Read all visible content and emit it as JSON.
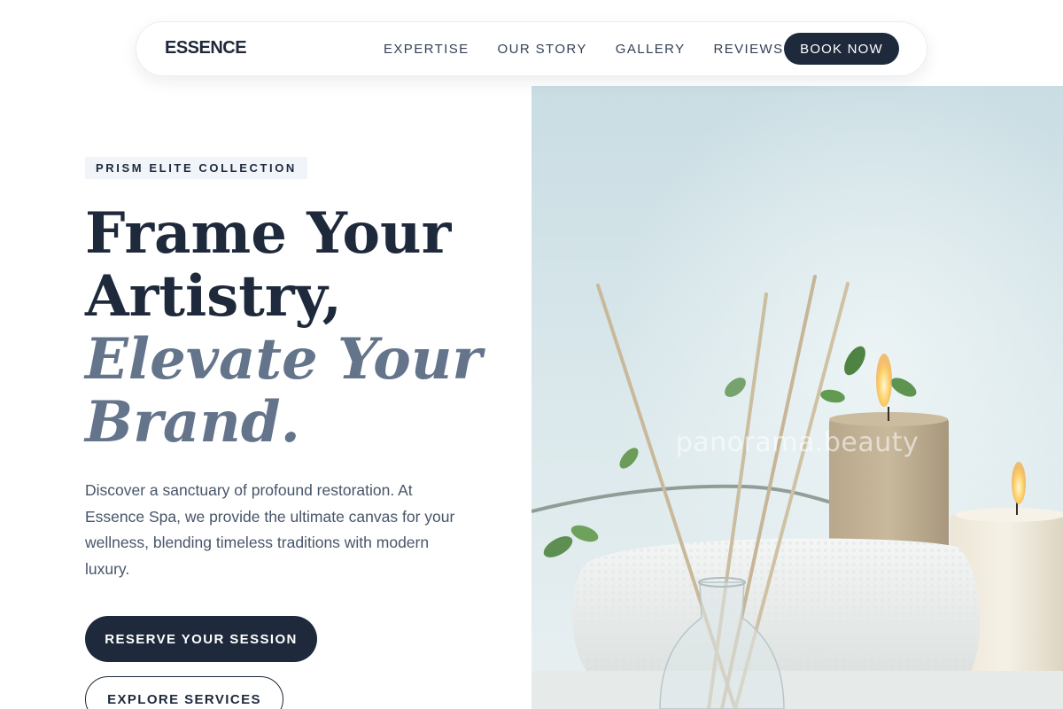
{
  "brand": {
    "logo": "ESSENCE"
  },
  "nav": {
    "links": [
      "EXPERTISE",
      "OUR STORY",
      "GALLERY",
      "REVIEWS"
    ],
    "cta": "BOOK NOW"
  },
  "hero": {
    "badge": "PRISM ELITE COLLECTION",
    "headline": {
      "line1": "Frame Your",
      "line2": "Artistry,",
      "accent1": "Elevate Your",
      "accent2": "Brand."
    },
    "description": "Discover a sanctuary of profound restoration. At Essence Spa, we provide the ultimate canvas for your wellness, blending timeless traditions with modern luxury.",
    "primary_button": "RESERVE YOUR SESSION",
    "secondary_button": "EXPLORE SERVICES",
    "image": {
      "watermark": "panorama.beauty"
    }
  },
  "colors": {
    "primary": "#1e293b",
    "accent_text": "#64748b",
    "body_text": "#475569",
    "badge_bg": "#f1f5f9"
  }
}
